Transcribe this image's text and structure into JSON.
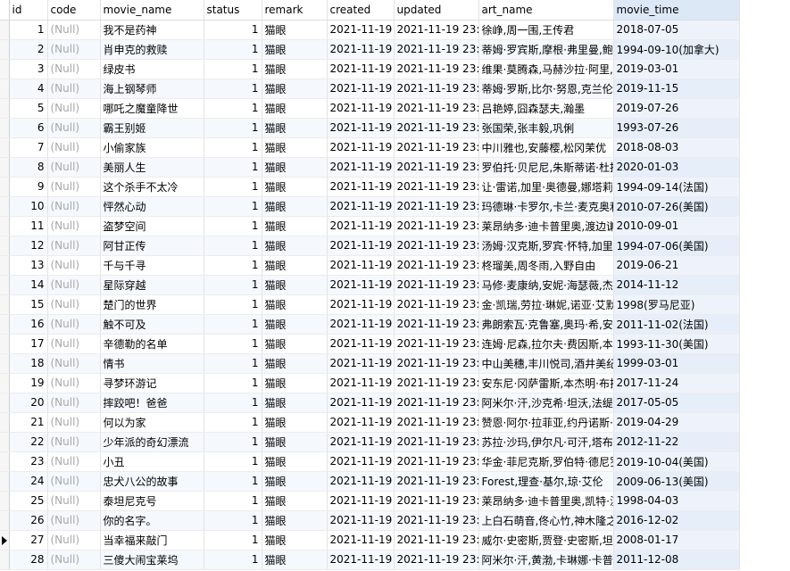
{
  "columns": [
    "id",
    "code",
    "movie_name",
    "status",
    "remark",
    "created",
    "updated",
    "art_name",
    "movie_time"
  ],
  "sorted_column": "movie_time",
  "current_row_index": 26,
  "rows": [
    {
      "id": "1",
      "code": "(Null)",
      "movie_name": "我不是药神",
      "status": "1",
      "remark": "猫眼",
      "created": "2021-11-19 2",
      "updated": "2021-11-19 23:",
      "art_name": "徐峥,周一围,王传君",
      "movie_time": "2018-07-05"
    },
    {
      "id": "2",
      "code": "(Null)",
      "movie_name": "肖申克的救赎",
      "status": "1",
      "remark": "猫眼",
      "created": "2021-11-19 2",
      "updated": "2021-11-19 23:",
      "art_name": "蒂姆·罗宾斯,摩根·弗里曼,鲍",
      "movie_time": "1994-09-10(加拿大)"
    },
    {
      "id": "3",
      "code": "(Null)",
      "movie_name": "绿皮书",
      "status": "1",
      "remark": "猫眼",
      "created": "2021-11-19 2",
      "updated": "2021-11-19 23:",
      "art_name": "维果·莫腾森,马赫沙拉·阿里,",
      "movie_time": "2019-03-01"
    },
    {
      "id": "4",
      "code": "(Null)",
      "movie_name": "海上钢琴师",
      "status": "1",
      "remark": "猫眼",
      "created": "2021-11-19 2",
      "updated": "2021-11-19 23:",
      "art_name": "蒂姆·罗斯,比尔·努恩,克兰伦",
      "movie_time": "2019-11-15"
    },
    {
      "id": "5",
      "code": "(Null)",
      "movie_name": "哪吒之魔童降世",
      "status": "1",
      "remark": "猫眼",
      "created": "2021-11-19 2",
      "updated": "2021-11-19 23:",
      "art_name": "吕艳婷,囧森瑟夫,瀚墨",
      "movie_time": "2019-07-26"
    },
    {
      "id": "6",
      "code": "(Null)",
      "movie_name": "霸王别姬",
      "status": "1",
      "remark": "猫眼",
      "created": "2021-11-19 2",
      "updated": "2021-11-19 23:",
      "art_name": "张国荣,张丰毅,巩俐",
      "movie_time": "1993-07-26"
    },
    {
      "id": "7",
      "code": "(Null)",
      "movie_name": "小偷家族",
      "status": "1",
      "remark": "猫眼",
      "created": "2021-11-19 2",
      "updated": "2021-11-19 23:",
      "art_name": "中川雅也,安藤樱,松冈茉优",
      "movie_time": "2018-08-03"
    },
    {
      "id": "8",
      "code": "(Null)",
      "movie_name": "美丽人生",
      "status": "1",
      "remark": "猫眼",
      "created": "2021-11-19 2",
      "updated": "2021-11-19 23:",
      "art_name": "罗伯托·贝尼尼,朱斯蒂诺·杜托",
      "movie_time": "2020-01-03"
    },
    {
      "id": "9",
      "code": "(Null)",
      "movie_name": "这个杀手不太冷",
      "status": "1",
      "remark": "猫眼",
      "created": "2021-11-19 2",
      "updated": "2021-11-19 23:",
      "art_name": "让·雷诺,加里·奥德曼,娜塔莉·",
      "movie_time": "1994-09-14(法国)"
    },
    {
      "id": "10",
      "code": "(Null)",
      "movie_name": "怦然心动",
      "status": "1",
      "remark": "猫眼",
      "created": "2021-11-19 2",
      "updated": "2021-11-19 23:",
      "art_name": "玛德琳·卡罗尔,卡兰·麦克奥利",
      "movie_time": "2010-07-26(美国)"
    },
    {
      "id": "11",
      "code": "(Null)",
      "movie_name": "盗梦空间",
      "status": "1",
      "remark": "猫眼",
      "created": "2021-11-19 2",
      "updated": "2021-11-19 23:",
      "art_name": "莱昂纳多·迪卡普里奥,渡边谦",
      "movie_time": "2010-09-01"
    },
    {
      "id": "12",
      "code": "(Null)",
      "movie_name": "阿甘正传",
      "status": "1",
      "remark": "猫眼",
      "created": "2021-11-19 2",
      "updated": "2021-11-19 23:",
      "art_name": "汤姆·汉克斯,罗宾·怀特,加里·",
      "movie_time": "1994-07-06(美国)"
    },
    {
      "id": "13",
      "code": "(Null)",
      "movie_name": "千与千寻",
      "status": "1",
      "remark": "猫眼",
      "created": "2021-11-19 2",
      "updated": "2021-11-19 23:",
      "art_name": "柊瑠美,周冬雨,入野自由",
      "movie_time": "2019-06-21"
    },
    {
      "id": "14",
      "code": "(Null)",
      "movie_name": "星际穿越",
      "status": "1",
      "remark": "猫眼",
      "created": "2021-11-19 2",
      "updated": "2021-11-19 23:",
      "art_name": "马修·麦康纳,安妮·海瑟薇,杰西",
      "movie_time": "2014-11-12"
    },
    {
      "id": "15",
      "code": "(Null)",
      "movie_name": "楚门的世界",
      "status": "1",
      "remark": "猫眼",
      "created": "2021-11-19 2",
      "updated": "2021-11-19 23:",
      "art_name": "金·凯瑞,劳拉·琳妮,诺亚·艾默",
      "movie_time": "1998(罗马尼亚)"
    },
    {
      "id": "16",
      "code": "(Null)",
      "movie_name": "触不可及",
      "status": "1",
      "remark": "猫眼",
      "created": "2021-11-19 2",
      "updated": "2021-11-19 23:",
      "art_name": "弗朗索瓦·克鲁塞,奥玛·希,安娜",
      "movie_time": "2011-11-02(法国)"
    },
    {
      "id": "17",
      "code": "(Null)",
      "movie_name": "辛德勒的名单",
      "status": "1",
      "remark": "猫眼",
      "created": "2021-11-19 2",
      "updated": "2021-11-19 23:",
      "art_name": "连姆·尼森,拉尔夫·费因斯,本·",
      "movie_time": "1993-11-30(美国)"
    },
    {
      "id": "18",
      "code": "(Null)",
      "movie_name": "情书",
      "status": "1",
      "remark": "猫眼",
      "created": "2021-11-19 2",
      "updated": "2021-11-19 23:",
      "art_name": "中山美穗,丰川悦司,酒井美纪",
      "movie_time": "1999-03-01"
    },
    {
      "id": "19",
      "code": "(Null)",
      "movie_name": "寻梦环游记",
      "status": "1",
      "remark": "猫眼",
      "created": "2021-11-19 2",
      "updated": "2021-11-19 23:",
      "art_name": "安东尼·冈萨雷斯,本杰明·布拉",
      "movie_time": "2017-11-24"
    },
    {
      "id": "20",
      "code": "(Null)",
      "movie_name": "摔跤吧！爸爸",
      "status": "1",
      "remark": "猫眼",
      "created": "2021-11-19 2",
      "updated": "2021-11-19 23:",
      "art_name": "阿米尔·汗,沙克希·坦沃,法缇玛",
      "movie_time": "2017-05-05"
    },
    {
      "id": "21",
      "code": "(Null)",
      "movie_name": "何以为家",
      "status": "1",
      "remark": "猫眼",
      "created": "2021-11-19 2",
      "updated": "2021-11-19 23:",
      "art_name": "赞恩·阿尔·拉菲亚,约丹诺斯·希",
      "movie_time": "2019-04-29"
    },
    {
      "id": "22",
      "code": "(Null)",
      "movie_name": "少年派的奇幻漂流",
      "status": "1",
      "remark": "猫眼",
      "created": "2021-11-19 2",
      "updated": "2021-11-19 23:",
      "art_name": "苏拉·沙玛,伊尔凡·可汗,塔布",
      "movie_time": "2012-11-22"
    },
    {
      "id": "23",
      "code": "(Null)",
      "movie_name": "小丑",
      "status": "1",
      "remark": "猫眼",
      "created": "2021-11-19 2",
      "updated": "2021-11-19 23:",
      "art_name": "华金·菲尼克斯,罗伯特·德尼罗",
      "movie_time": "2019-10-04(美国)"
    },
    {
      "id": "24",
      "code": "(Null)",
      "movie_name": "忠犬八公的故事",
      "status": "1",
      "remark": "猫眼",
      "created": "2021-11-19 2",
      "updated": "2021-11-19 23:",
      "art_name": "Forest,理查·基尔,琼·艾伦",
      "movie_time": "2009-06-13(美国)"
    },
    {
      "id": "25",
      "code": "(Null)",
      "movie_name": "泰坦尼克号",
      "status": "1",
      "remark": "猫眼",
      "created": "2021-11-19 2",
      "updated": "2021-11-19 23:",
      "art_name": "莱昂纳多·迪卡普里奥,凯特·温",
      "movie_time": "1998-04-03"
    },
    {
      "id": "26",
      "code": "(Null)",
      "movie_name": "你的名字。",
      "status": "1",
      "remark": "猫眼",
      "created": "2021-11-19 2",
      "updated": "2021-11-19 23:",
      "art_name": "上白石萌音,佟心竹,神木隆之",
      "movie_time": "2016-12-02"
    },
    {
      "id": "27",
      "code": "(Null)",
      "movie_name": "当幸福来敲门",
      "status": "1",
      "remark": "猫眼",
      "created": "2021-11-19 2",
      "updated": "2021-11-19 23:",
      "art_name": "威尔·史密斯,贾登·史密斯,坦",
      "movie_time": "2008-01-17"
    },
    {
      "id": "28",
      "code": "(Null)",
      "movie_name": "三傻大闹宝莱坞",
      "status": "1",
      "remark": "猫眼",
      "created": "2021-11-19 2",
      "updated": "2021-11-19 23:",
      "art_name": "阿米尔·汗,黄渤,卡琳娜·卡普",
      "movie_time": "2011-12-08"
    }
  ]
}
